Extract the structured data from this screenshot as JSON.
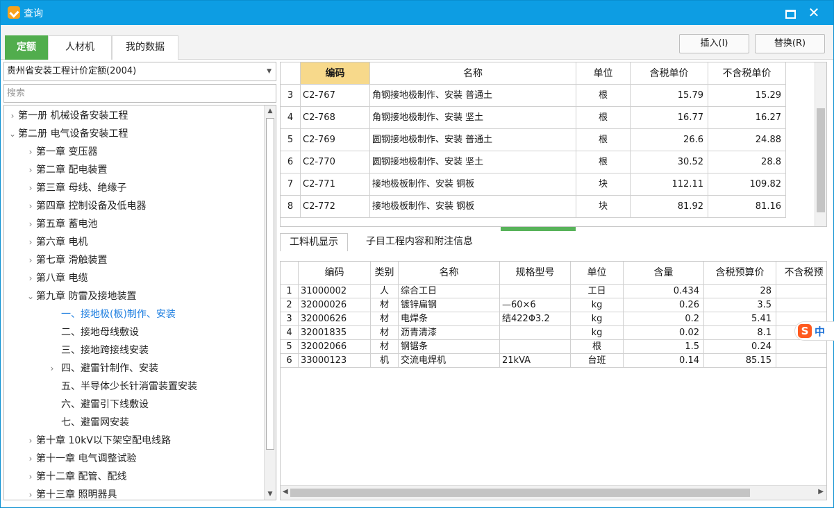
{
  "window": {
    "title": "查询"
  },
  "toolbar": {
    "tabs": [
      "定额",
      "人材机",
      "我的数据"
    ],
    "insert_label": "插入(I)",
    "replace_label": "替换(R)"
  },
  "left": {
    "dropdown_value": "贵州省安装工程计价定额(2004)",
    "search_placeholder": "搜索",
    "tree": [
      {
        "text": "第一册 机械设备安装工程",
        "level": 0,
        "caret": ">"
      },
      {
        "text": "第二册 电气设备安装工程",
        "level": 0,
        "caret": "v"
      },
      {
        "text": "第一章 变压器",
        "level": 1,
        "caret": ">"
      },
      {
        "text": "第二章 配电装置",
        "level": 1,
        "caret": ">"
      },
      {
        "text": "第三章 母线、绝缘子",
        "level": 1,
        "caret": ">"
      },
      {
        "text": "第四章 控制设备及低电器",
        "level": 1,
        "caret": ">"
      },
      {
        "text": "第五章 蓄电池",
        "level": 1,
        "caret": ">"
      },
      {
        "text": "第六章 电机",
        "level": 1,
        "caret": ">"
      },
      {
        "text": "第七章 滑触装置",
        "level": 1,
        "caret": ">"
      },
      {
        "text": "第八章 电缆",
        "level": 1,
        "caret": ">"
      },
      {
        "text": "第九章 防雷及接地装置",
        "level": 1,
        "caret": "v"
      },
      {
        "text": "一、接地极(板)制作、安装",
        "level": 2,
        "caret": "",
        "selected": true
      },
      {
        "text": "二、接地母线敷设",
        "level": 2,
        "caret": ""
      },
      {
        "text": "三、接地跨接线安装",
        "level": 2,
        "caret": ""
      },
      {
        "text": "四、避雷针制作、安装",
        "level": 2,
        "caret": ">"
      },
      {
        "text": "五、半导体少长针消雷装置安装",
        "level": 2,
        "caret": ""
      },
      {
        "text": "六、避雷引下线敷设",
        "level": 2,
        "caret": ""
      },
      {
        "text": "七、避雷网安装",
        "level": 2,
        "caret": ""
      },
      {
        "text": "第十章 10kV以下架空配电线路",
        "level": 1,
        "caret": ">"
      },
      {
        "text": "第十一章 电气调整试验",
        "level": 1,
        "caret": ">"
      },
      {
        "text": "第十二章 配管、配线",
        "level": 1,
        "caret": ">"
      },
      {
        "text": "第十三章 照明器具",
        "level": 1,
        "caret": ">"
      }
    ]
  },
  "grid1": {
    "headers": [
      "",
      "编码",
      "名称",
      "单位",
      "含税单价",
      "不含税单价"
    ],
    "rows": [
      [
        "3",
        "C2-767",
        "角钢接地极制作、安装 普通土",
        "根",
        "15.79",
        "15.29"
      ],
      [
        "4",
        "C2-768",
        "角钢接地极制作、安装 坚土",
        "根",
        "16.77",
        "16.27"
      ],
      [
        "5",
        "C2-769",
        "圆钢接地极制作、安装 普通土",
        "根",
        "26.6",
        "24.88"
      ],
      [
        "6",
        "C2-770",
        "圆钢接地极制作、安装 坚土",
        "根",
        "30.52",
        "28.8"
      ],
      [
        "7",
        "C2-771",
        "接地极板制作、安装 铜板",
        "块",
        "112.11",
        "109.82"
      ],
      [
        "8",
        "C2-772",
        "接地极板制作、安装 钢板",
        "块",
        "81.92",
        "81.16"
      ]
    ]
  },
  "subtabs": [
    "工料机显示",
    "子目工程内容和附注信息"
  ],
  "grid2": {
    "headers": [
      "",
      "编码",
      "类别",
      "名称",
      "规格型号",
      "单位",
      "含量",
      "含税预算价",
      "不含税预"
    ],
    "rows": [
      [
        "1",
        "31000002",
        "人",
        "综合工日",
        "",
        "工日",
        "0.434",
        "28",
        ""
      ],
      [
        "2",
        "32000026",
        "材",
        "镀锌扁钢",
        "—60×6",
        "kg",
        "0.26",
        "3.5",
        ""
      ],
      [
        "3",
        "32000626",
        "材",
        "电焊条",
        "结422Φ3.2",
        "kg",
        "0.2",
        "5.41",
        ""
      ],
      [
        "4",
        "32001835",
        "材",
        "沥青清漆",
        "",
        "kg",
        "0.02",
        "8.1",
        ""
      ],
      [
        "5",
        "32002066",
        "材",
        "钢锯条",
        "",
        "根",
        "1.5",
        "0.24",
        ""
      ],
      [
        "6",
        "33000123",
        "机",
        "交流电焊机",
        "21kVA",
        "台班",
        "0.14",
        "85.15",
        ""
      ]
    ]
  },
  "ime": {
    "logo": "S",
    "text": "中"
  }
}
